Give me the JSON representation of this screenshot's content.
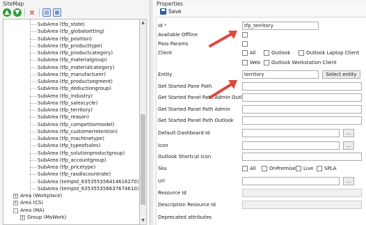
{
  "sitemap": {
    "title": "SiteMap",
    "tree_items": [
      "SubArea (tfp_state)",
      "SubArea (tfp_globalsetting)",
      "SubArea (tfp_position)",
      "SubArea (tfp_producttype)",
      "SubArea (tfp_productcategory)",
      "SubArea (tfp_materialgroup)",
      "SubArea (tfp_materialcategory)",
      "SubArea (tfp_manufacturer)",
      "SubArea (tfp_productsegment)",
      "SubArea (tfp_deductiongroup)",
      "SubArea (tfp_industry)",
      "SubArea (tfp_salescycle)",
      "SubArea (tfp_territory)",
      "SubArea (tfp_reason)",
      "SubArea (tfp_competitormodel)",
      "SubArea (tfp_customerretention)",
      "SubArea (tfp_machinetype)",
      "SubArea (tfp_typeofsales)",
      "SubArea (tfp_solutionproductgroup)",
      "SubArea (tfp_accountgroup)",
      "SubArea (tfp_pricetype)",
      "SubArea (tfp_rasdiscountrate)",
      "SubArea (tempId_635355356414616270)",
      "SubArea (tempId_635355356637674610)"
    ],
    "area_items": [
      {
        "expander": "+",
        "label": "Area (Workplace)"
      },
      {
        "expander": "+",
        "label": "Area (CS)"
      },
      {
        "expander": "-",
        "label": "Area (MA)"
      },
      {
        "expander": "+",
        "label": "Group (MsWork)"
      }
    ]
  },
  "properties": {
    "title": "Properties",
    "save_label": "Save",
    "id_label": "Id",
    "id_required": "*",
    "id_value": "tfp_territory",
    "available_offline_label": "Available Offline",
    "pass_params_label": "Pass Params",
    "client_label": "Client",
    "client_options": [
      "All",
      "Outlook",
      "Outlook Laptop Client",
      "Web",
      "Outlook Workstation Client"
    ],
    "entity_label": "Entity",
    "entity_value": "territory",
    "select_entity_label": "Select entity",
    "get_started_pane_path_label": "Get Started Pane Path",
    "get_started_admin_outlook_label": "Get Started Panel Path Admin Outlook",
    "get_started_admin_label": "Get Started Panel Path Admin",
    "get_started_outlook_label": "Get Started Panel Path Outlook",
    "default_dashboard_label": "Default Dashboard Id",
    "icon_label": "Icon",
    "outlook_shortcut_icon_label": "Outlook Shortcut Icon",
    "sku_label": "Sku",
    "sku_options": [
      "All",
      "OnPremise",
      "Live",
      "SPLA"
    ],
    "url_label": "Url",
    "resource_id_label": "Resource Id",
    "description_resource_id_label": "Description Resource Id",
    "deprecated_label": "Deprecated attributes",
    "browse_label": "..."
  },
  "colors": {
    "selection": "#3f88d8",
    "arrow": "#e0473c",
    "delete": "#d0251b",
    "add": "#2e9e3a"
  }
}
